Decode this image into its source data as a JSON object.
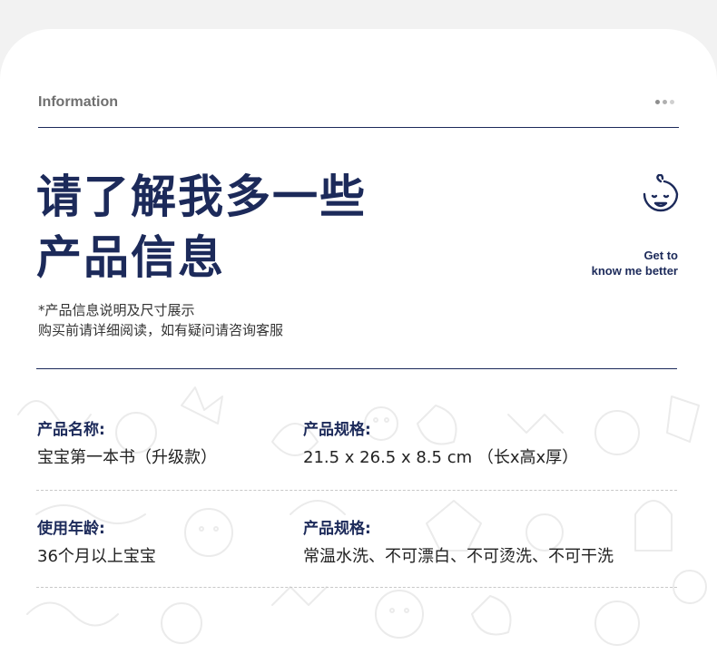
{
  "header": {
    "label": "Information"
  },
  "colors": {
    "navy": "#1c2a5a",
    "dot_dark": "#8e8e8e",
    "dot_light": "#c8c8c8",
    "doodle": "#e9e9e9"
  },
  "title": {
    "line1": "请了解我多一些",
    "line2": "产品信息"
  },
  "side_note": {
    "line1": "Get to",
    "line2": "know me better"
  },
  "icons": {
    "baby": "baby-face-icon",
    "menu": "more-dots-icon"
  },
  "note": {
    "line1": "*产品信息说明及尺寸展示",
    "line2": " 购买前请详细阅读，如有疑问请咨询客服"
  },
  "fields": [
    {
      "label": "产品名称:",
      "value": "宝宝第一本书（升级款）"
    },
    {
      "label": "产品规格:",
      "value": "21.5 x 26.5 x 8.5 cm （长x高x厚）"
    },
    {
      "label": "使用年龄:",
      "value": "36个月以上宝宝"
    },
    {
      "label": "产品规格:",
      "value": "常温水洗、不可漂白、不可烫洗、不可干洗"
    }
  ]
}
